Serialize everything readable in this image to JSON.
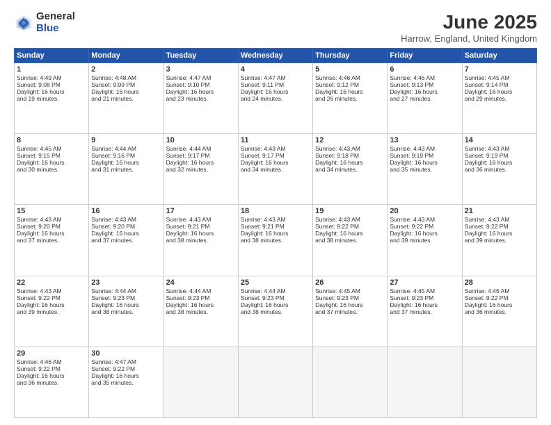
{
  "logo": {
    "general": "General",
    "blue": "Blue"
  },
  "title": "June 2025",
  "subtitle": "Harrow, England, United Kingdom",
  "days_of_week": [
    "Sunday",
    "Monday",
    "Tuesday",
    "Wednesday",
    "Thursday",
    "Friday",
    "Saturday"
  ],
  "weeks": [
    [
      {
        "day": 1,
        "lines": [
          "Sunrise: 4:49 AM",
          "Sunset: 9:08 PM",
          "Daylight: 16 hours",
          "and 19 minutes."
        ]
      },
      {
        "day": 2,
        "lines": [
          "Sunrise: 4:48 AM",
          "Sunset: 9:09 PM",
          "Daylight: 16 hours",
          "and 21 minutes."
        ]
      },
      {
        "day": 3,
        "lines": [
          "Sunrise: 4:47 AM",
          "Sunset: 9:10 PM",
          "Daylight: 16 hours",
          "and 23 minutes."
        ]
      },
      {
        "day": 4,
        "lines": [
          "Sunrise: 4:47 AM",
          "Sunset: 9:11 PM",
          "Daylight: 16 hours",
          "and 24 minutes."
        ]
      },
      {
        "day": 5,
        "lines": [
          "Sunrise: 4:46 AM",
          "Sunset: 9:12 PM",
          "Daylight: 16 hours",
          "and 26 minutes."
        ]
      },
      {
        "day": 6,
        "lines": [
          "Sunrise: 4:46 AM",
          "Sunset: 9:13 PM",
          "Daylight: 16 hours",
          "and 27 minutes."
        ]
      },
      {
        "day": 7,
        "lines": [
          "Sunrise: 4:45 AM",
          "Sunset: 9:14 PM",
          "Daylight: 16 hours",
          "and 29 minutes."
        ]
      }
    ],
    [
      {
        "day": 8,
        "lines": [
          "Sunrise: 4:45 AM",
          "Sunset: 9:15 PM",
          "Daylight: 16 hours",
          "and 30 minutes."
        ]
      },
      {
        "day": 9,
        "lines": [
          "Sunrise: 4:44 AM",
          "Sunset: 9:16 PM",
          "Daylight: 16 hours",
          "and 31 minutes."
        ]
      },
      {
        "day": 10,
        "lines": [
          "Sunrise: 4:44 AM",
          "Sunset: 9:17 PM",
          "Daylight: 16 hours",
          "and 32 minutes."
        ]
      },
      {
        "day": 11,
        "lines": [
          "Sunrise: 4:43 AM",
          "Sunset: 9:17 PM",
          "Daylight: 16 hours",
          "and 34 minutes."
        ]
      },
      {
        "day": 12,
        "lines": [
          "Sunrise: 4:43 AM",
          "Sunset: 9:18 PM",
          "Daylight: 16 hours",
          "and 34 minutes."
        ]
      },
      {
        "day": 13,
        "lines": [
          "Sunrise: 4:43 AM",
          "Sunset: 9:19 PM",
          "Daylight: 16 hours",
          "and 35 minutes."
        ]
      },
      {
        "day": 14,
        "lines": [
          "Sunrise: 4:43 AM",
          "Sunset: 9:19 PM",
          "Daylight: 16 hours",
          "and 36 minutes."
        ]
      }
    ],
    [
      {
        "day": 15,
        "lines": [
          "Sunrise: 4:43 AM",
          "Sunset: 9:20 PM",
          "Daylight: 16 hours",
          "and 37 minutes."
        ]
      },
      {
        "day": 16,
        "lines": [
          "Sunrise: 4:43 AM",
          "Sunset: 9:20 PM",
          "Daylight: 16 hours",
          "and 37 minutes."
        ]
      },
      {
        "day": 17,
        "lines": [
          "Sunrise: 4:43 AM",
          "Sunset: 9:21 PM",
          "Daylight: 16 hours",
          "and 38 minutes."
        ]
      },
      {
        "day": 18,
        "lines": [
          "Sunrise: 4:43 AM",
          "Sunset: 9:21 PM",
          "Daylight: 16 hours",
          "and 38 minutes."
        ]
      },
      {
        "day": 19,
        "lines": [
          "Sunrise: 4:43 AM",
          "Sunset: 9:22 PM",
          "Daylight: 16 hours",
          "and 38 minutes."
        ]
      },
      {
        "day": 20,
        "lines": [
          "Sunrise: 4:43 AM",
          "Sunset: 9:22 PM",
          "Daylight: 16 hours",
          "and 39 minutes."
        ]
      },
      {
        "day": 21,
        "lines": [
          "Sunrise: 4:43 AM",
          "Sunset: 9:22 PM",
          "Daylight: 16 hours",
          "and 39 minutes."
        ]
      }
    ],
    [
      {
        "day": 22,
        "lines": [
          "Sunrise: 4:43 AM",
          "Sunset: 9:22 PM",
          "Daylight: 16 hours",
          "and 39 minutes."
        ]
      },
      {
        "day": 23,
        "lines": [
          "Sunrise: 4:44 AM",
          "Sunset: 9:23 PM",
          "Daylight: 16 hours",
          "and 38 minutes."
        ]
      },
      {
        "day": 24,
        "lines": [
          "Sunrise: 4:44 AM",
          "Sunset: 9:23 PM",
          "Daylight: 16 hours",
          "and 38 minutes."
        ]
      },
      {
        "day": 25,
        "lines": [
          "Sunrise: 4:44 AM",
          "Sunset: 9:23 PM",
          "Daylight: 16 hours",
          "and 38 minutes."
        ]
      },
      {
        "day": 26,
        "lines": [
          "Sunrise: 4:45 AM",
          "Sunset: 9:23 PM",
          "Daylight: 16 hours",
          "and 37 minutes."
        ]
      },
      {
        "day": 27,
        "lines": [
          "Sunrise: 4:45 AM",
          "Sunset: 9:23 PM",
          "Daylight: 16 hours",
          "and 37 minutes."
        ]
      },
      {
        "day": 28,
        "lines": [
          "Sunrise: 4:46 AM",
          "Sunset: 9:22 PM",
          "Daylight: 16 hours",
          "and 36 minutes."
        ]
      }
    ],
    [
      {
        "day": 29,
        "lines": [
          "Sunrise: 4:46 AM",
          "Sunset: 9:22 PM",
          "Daylight: 16 hours",
          "and 36 minutes."
        ]
      },
      {
        "day": 30,
        "lines": [
          "Sunrise: 4:47 AM",
          "Sunset: 9:22 PM",
          "Daylight: 16 hours",
          "and 35 minutes."
        ]
      },
      null,
      null,
      null,
      null,
      null
    ]
  ]
}
